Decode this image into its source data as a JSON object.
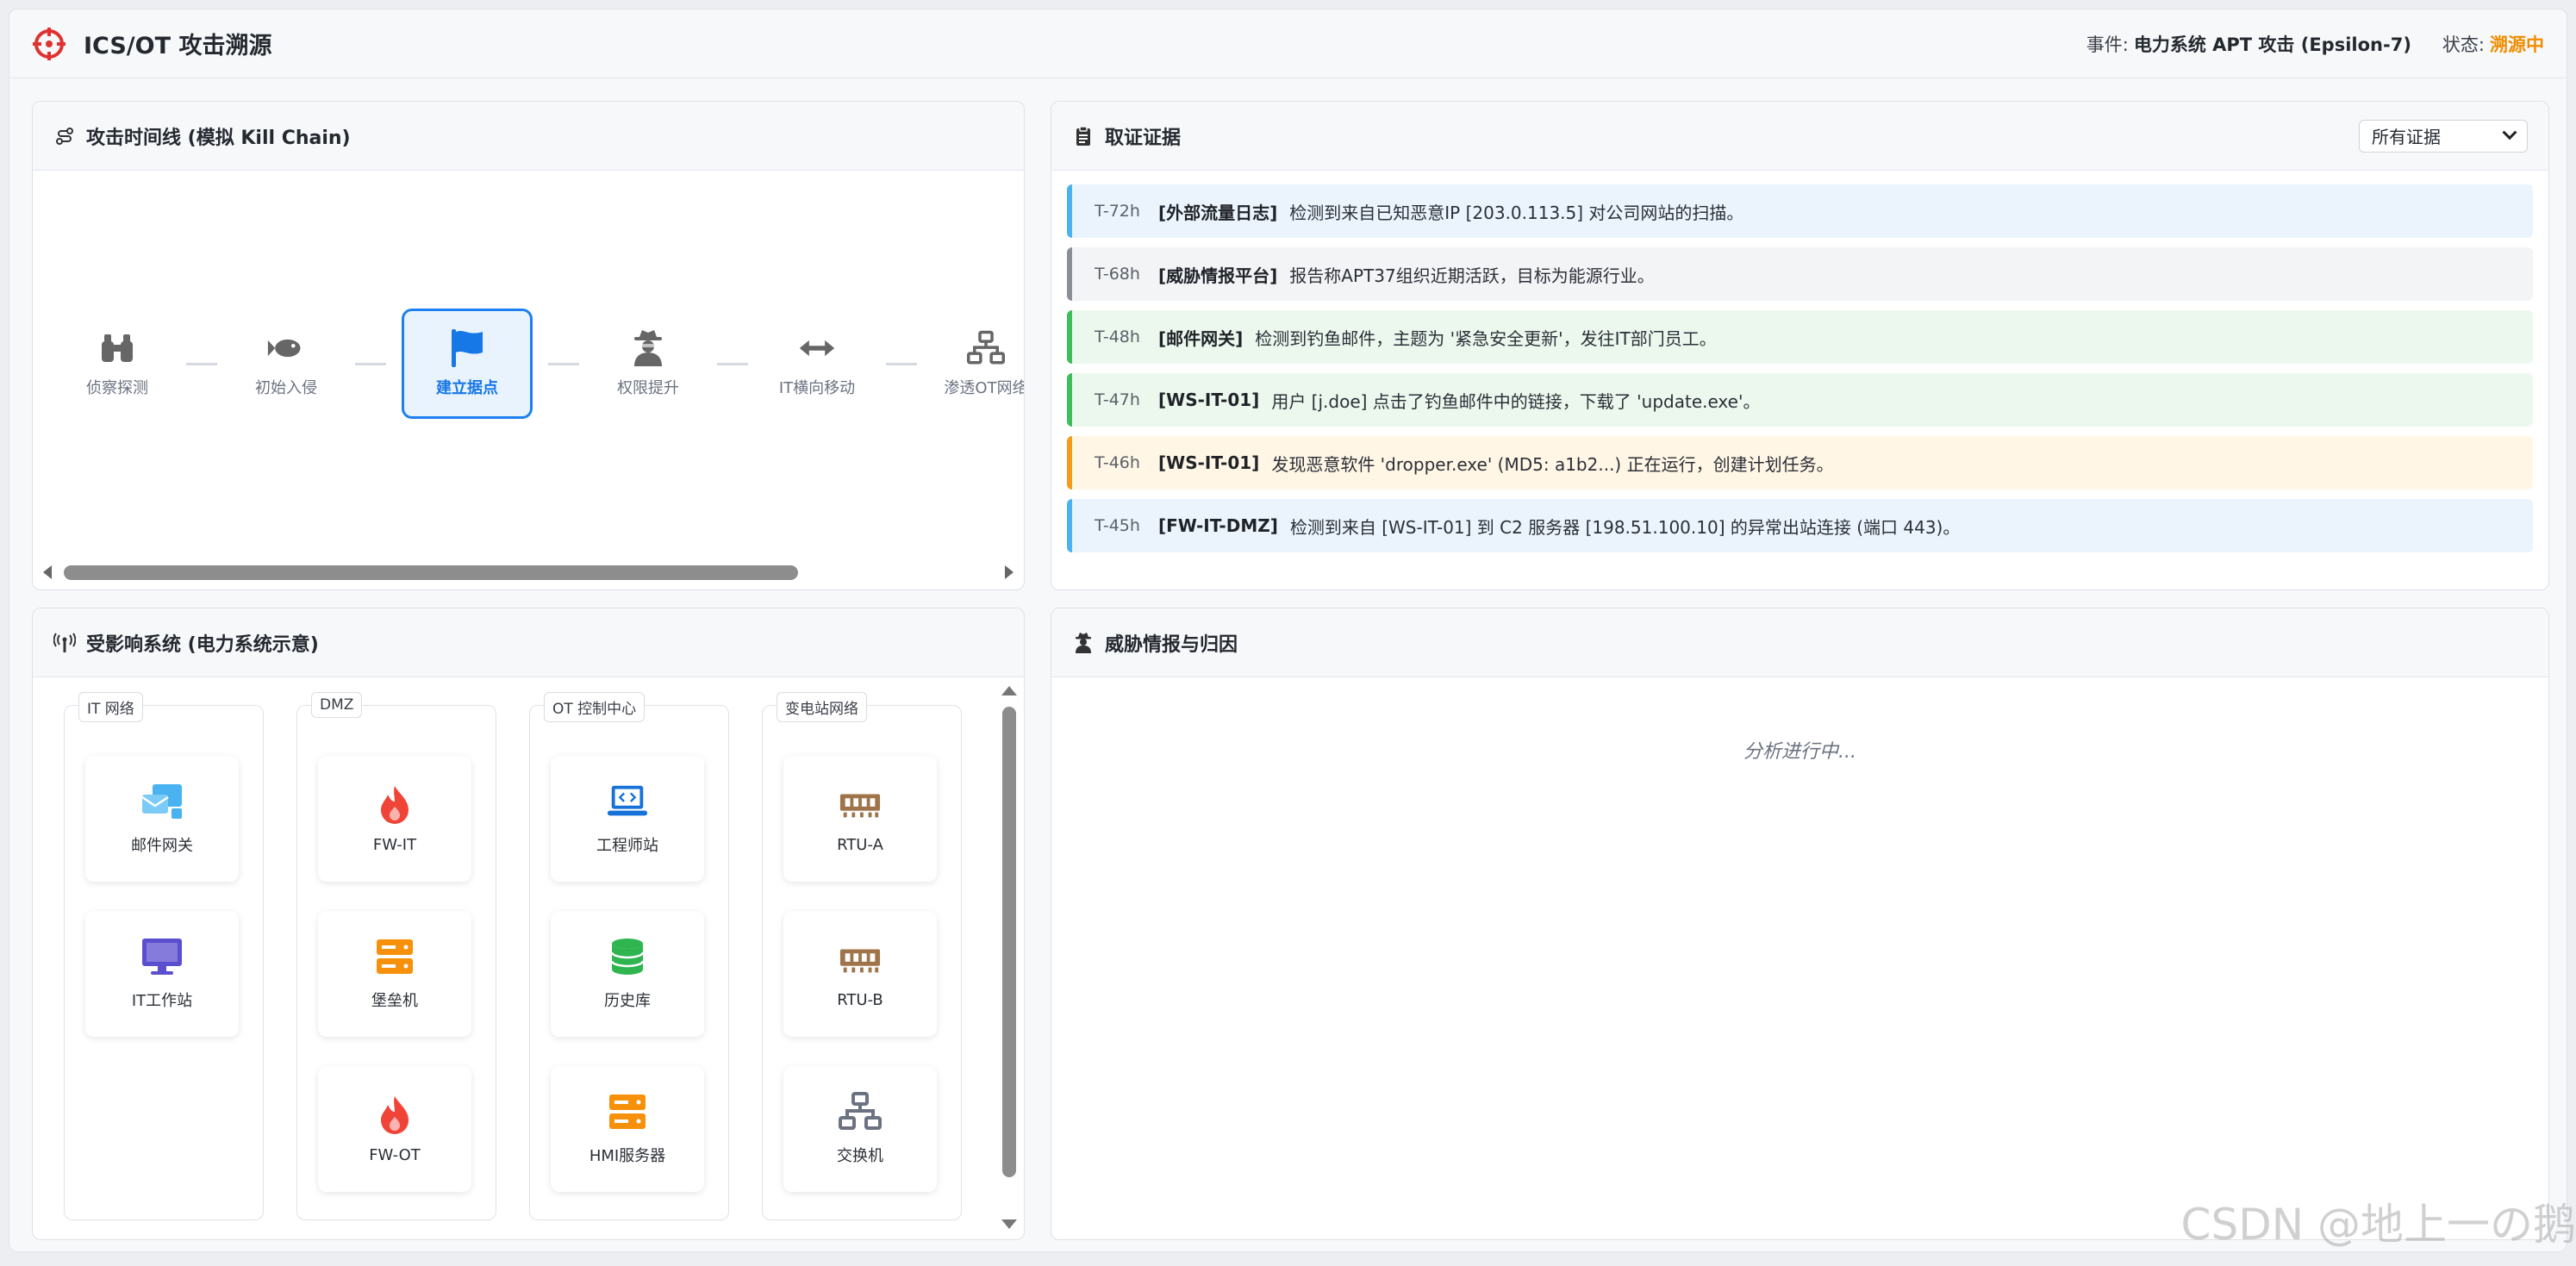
{
  "header": {
    "title": "ICS/OT 攻击溯源",
    "incident_label": "事件:",
    "incident_value": "电力系统 APT 攻击 (Epsilon-7)",
    "status_label": "状态:",
    "status_value": "溯源中"
  },
  "timeline": {
    "title": "攻击时间线 (模拟 Kill Chain)",
    "steps": [
      {
        "label": "侦察探测",
        "icon": "binoculars-icon",
        "active": false
      },
      {
        "label": "初始入侵",
        "icon": "fish-icon",
        "active": false
      },
      {
        "label": "建立据点",
        "icon": "flag-icon",
        "active": true
      },
      {
        "label": "权限提升",
        "icon": "user-secret-icon",
        "active": false
      },
      {
        "label": "IT横向移动",
        "icon": "arrows-left-right-icon",
        "active": false
      },
      {
        "label": "渗透OT网络",
        "icon": "network-icon",
        "active": false
      }
    ],
    "truncated_step": "OT"
  },
  "evidence": {
    "title": "取证证据",
    "filter_value": "所有证据",
    "items": [
      {
        "time": "T-72h",
        "source": "[外部流量日志]",
        "text": "检测到来自已知恶意IP [203.0.113.5] 对公司网站的扫描。",
        "tone": "blue"
      },
      {
        "time": "T-68h",
        "source": "[威胁情报平台]",
        "text": "报告称APT37组织近期活跃，目标为能源行业。",
        "tone": "gray"
      },
      {
        "time": "T-48h",
        "source": "[邮件网关]",
        "text": "检测到钓鱼邮件，主题为 '紧急安全更新'，发往IT部门员工。",
        "tone": "green"
      },
      {
        "time": "T-47h",
        "source": "[WS-IT-01]",
        "text": "用户 [j.doe] 点击了钓鱼邮件中的链接，下载了 'update.exe'。",
        "tone": "green"
      },
      {
        "time": "T-46h",
        "source": "[WS-IT-01]",
        "text": "发现恶意软件 'dropper.exe' (MD5: a1b2...) 正在运行，创建计划任务。",
        "tone": "orange"
      },
      {
        "time": "T-45h",
        "source": "[FW-IT-DMZ]",
        "text": "检测到来自 [WS-IT-01] 到 C2 服务器 [198.51.100.10] 的异常出站连接 (端口 443)。",
        "tone": "blue"
      }
    ]
  },
  "systems": {
    "title": "受影响系统 (电力系统示意)",
    "zones": [
      {
        "label": "IT 网络",
        "nodes": [
          {
            "label": "邮件网关",
            "icon": "mail-gateway-icon",
            "color": "#4ab2f0"
          },
          {
            "label": "IT工作站",
            "icon": "desktop-icon",
            "color": "#5b4fcf"
          }
        ]
      },
      {
        "label": "DMZ",
        "nodes": [
          {
            "label": "FW-IT",
            "icon": "firewall-flame-icon",
            "color": "#f04438"
          },
          {
            "label": "堡垒机",
            "icon": "server-icon",
            "color": "#f7900a"
          },
          {
            "label": "FW-OT",
            "icon": "firewall-flame-icon",
            "color": "#f04438"
          }
        ]
      },
      {
        "label": "OT 控制中心",
        "nodes": [
          {
            "label": "工程师站",
            "icon": "laptop-code-icon",
            "color": "#1671d9"
          },
          {
            "label": "历史库",
            "icon": "database-icon",
            "color": "#2fb550"
          },
          {
            "label": "HMI服务器",
            "icon": "server-icon",
            "color": "#f7900a"
          }
        ]
      },
      {
        "label": "变电站网络",
        "nodes": [
          {
            "label": "RTU-A",
            "icon": "memory-icon",
            "color": "#a0744a"
          },
          {
            "label": "RTU-B",
            "icon": "memory-icon",
            "color": "#a0744a"
          },
          {
            "label": "交换机",
            "icon": "network-icon",
            "color": "#6b7280"
          }
        ]
      }
    ]
  },
  "intel": {
    "title": "威胁情报与归因",
    "status": "分析进行中..."
  },
  "watermark": "CSDN @地上一の鹅",
  "colors": {
    "accent": "#1e80f0",
    "status": "#f08c00"
  }
}
